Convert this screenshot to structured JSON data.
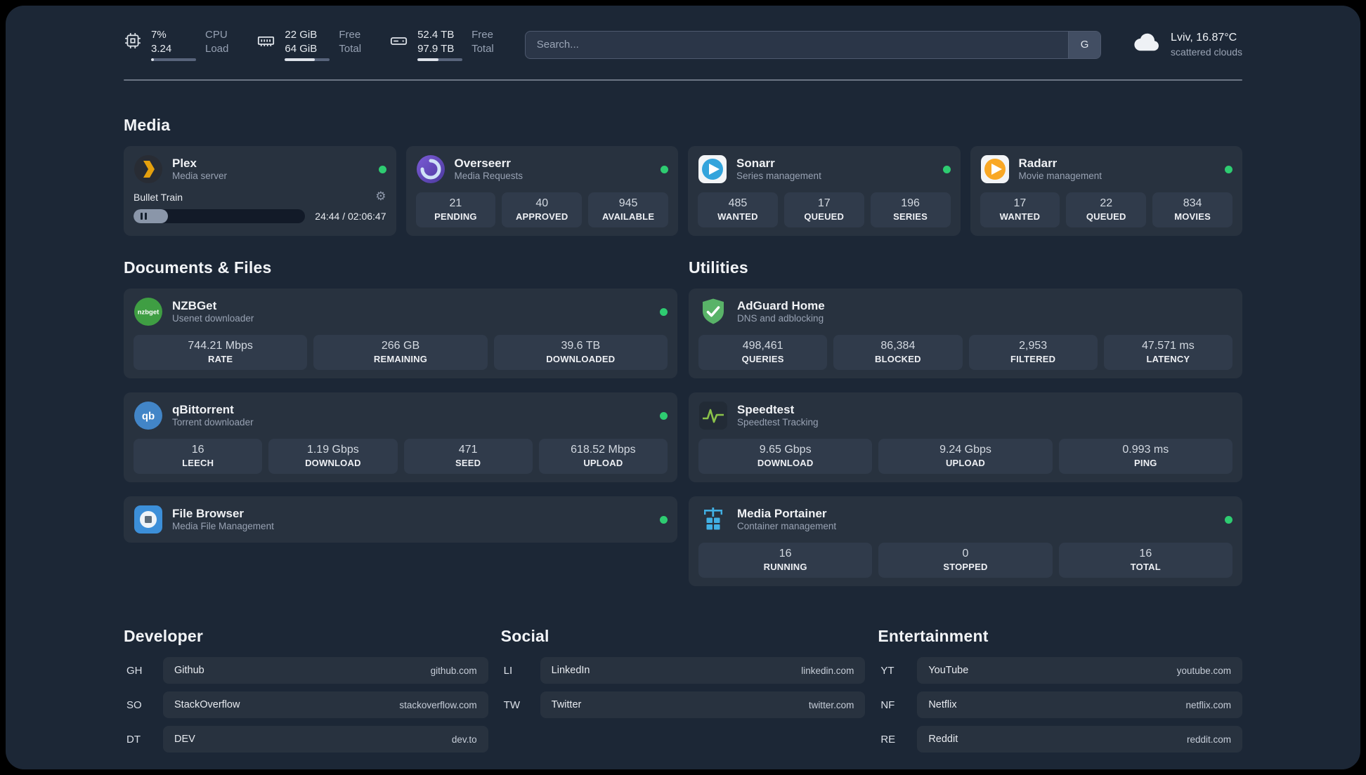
{
  "colors": {
    "background": "#1c2736",
    "card": "#28323f",
    "status_online": "#2ecc71",
    "accent_adguard": "#59b368",
    "accent_plex": "#e5a00d"
  },
  "topbar": {
    "resources": [
      {
        "line1": "7%",
        "line2": "3.24",
        "label1": "CPU",
        "label2": "Load",
        "usage_pct": 7
      },
      {
        "line1": "22 GiB",
        "line2": "64 GiB",
        "label1": "Free",
        "label2": "Total",
        "usage_pct": 66
      },
      {
        "line1": "52.4 TB",
        "line2": "97.9 TB",
        "label1": "Free",
        "label2": "Total",
        "usage_pct": 46
      }
    ],
    "search": {
      "placeholder": "Search...",
      "provider_label": "G"
    },
    "weather": {
      "location": "Lviv, 16.87°C",
      "condition": "scattered clouds"
    }
  },
  "sections": {
    "media": {
      "title": "Media"
    },
    "documents": {
      "title": "Documents & Files"
    },
    "utilities": {
      "title": "Utilities"
    }
  },
  "services": {
    "plex": {
      "name": "Plex",
      "desc": "Media server",
      "now_playing": "Bullet Train",
      "time_display": "24:44 / 02:06:47",
      "progress_pct": 20
    },
    "overseerr": {
      "name": "Overseerr",
      "desc": "Media Requests",
      "stats": [
        {
          "value": "21",
          "label": "PENDING"
        },
        {
          "value": "40",
          "label": "APPROVED"
        },
        {
          "value": "945",
          "label": "AVAILABLE"
        }
      ]
    },
    "sonarr": {
      "name": "Sonarr",
      "desc": "Series management",
      "stats": [
        {
          "value": "485",
          "label": "WANTED"
        },
        {
          "value": "17",
          "label": "QUEUED"
        },
        {
          "value": "196",
          "label": "SERIES"
        }
      ]
    },
    "radarr": {
      "name": "Radarr",
      "desc": "Movie management",
      "stats": [
        {
          "value": "17",
          "label": "WANTED"
        },
        {
          "value": "22",
          "label": "QUEUED"
        },
        {
          "value": "834",
          "label": "MOVIES"
        }
      ]
    },
    "nzbget": {
      "name": "NZBGet",
      "desc": "Usenet downloader",
      "stats": [
        {
          "value": "744.21 Mbps",
          "label": "RATE"
        },
        {
          "value": "266 GB",
          "label": "REMAINING"
        },
        {
          "value": "39.6 TB",
          "label": "DOWNLOADED"
        }
      ]
    },
    "qbittorrent": {
      "name": "qBittorrent",
      "desc": "Torrent downloader",
      "stats": [
        {
          "value": "16",
          "label": "LEECH"
        },
        {
          "value": "1.19 Gbps",
          "label": "DOWNLOAD"
        },
        {
          "value": "471",
          "label": "SEED"
        },
        {
          "value": "618.52 Mbps",
          "label": "UPLOAD"
        }
      ]
    },
    "filebrowser": {
      "name": "File Browser",
      "desc": "Media File Management"
    },
    "adguard": {
      "name": "AdGuard Home",
      "desc": "DNS and adblocking",
      "stats": [
        {
          "value": "498,461",
          "label": "QUERIES"
        },
        {
          "value": "86,384",
          "label": "BLOCKED"
        },
        {
          "value": "2,953",
          "label": "FILTERED"
        },
        {
          "value": "47.571 ms",
          "label": "LATENCY"
        }
      ]
    },
    "speedtest": {
      "name": "Speedtest",
      "desc": "Speedtest Tracking",
      "stats": [
        {
          "value": "9.65 Gbps",
          "label": "DOWNLOAD"
        },
        {
          "value": "9.24 Gbps",
          "label": "UPLOAD"
        },
        {
          "value": "0.993 ms",
          "label": "PING"
        }
      ]
    },
    "portainer": {
      "name": "Media Portainer",
      "desc": "Container management",
      "stats": [
        {
          "value": "16",
          "label": "RUNNING"
        },
        {
          "value": "0",
          "label": "STOPPED"
        },
        {
          "value": "16",
          "label": "TOTAL"
        }
      ]
    }
  },
  "bookmarks": {
    "developer": {
      "title": "Developer",
      "items": [
        {
          "abbr": "GH",
          "name": "Github",
          "url": "github.com"
        },
        {
          "abbr": "SO",
          "name": "StackOverflow",
          "url": "stackoverflow.com"
        },
        {
          "abbr": "DT",
          "name": "DEV",
          "url": "dev.to"
        }
      ]
    },
    "social": {
      "title": "Social",
      "items": [
        {
          "abbr": "LI",
          "name": "LinkedIn",
          "url": "linkedin.com"
        },
        {
          "abbr": "TW",
          "name": "Twitter",
          "url": "twitter.com"
        }
      ]
    },
    "entertainment": {
      "title": "Entertainment",
      "items": [
        {
          "abbr": "YT",
          "name": "YouTube",
          "url": "youtube.com"
        },
        {
          "abbr": "NF",
          "name": "Netflix",
          "url": "netflix.com"
        },
        {
          "abbr": "RE",
          "name": "Reddit",
          "url": "reddit.com"
        }
      ]
    }
  }
}
